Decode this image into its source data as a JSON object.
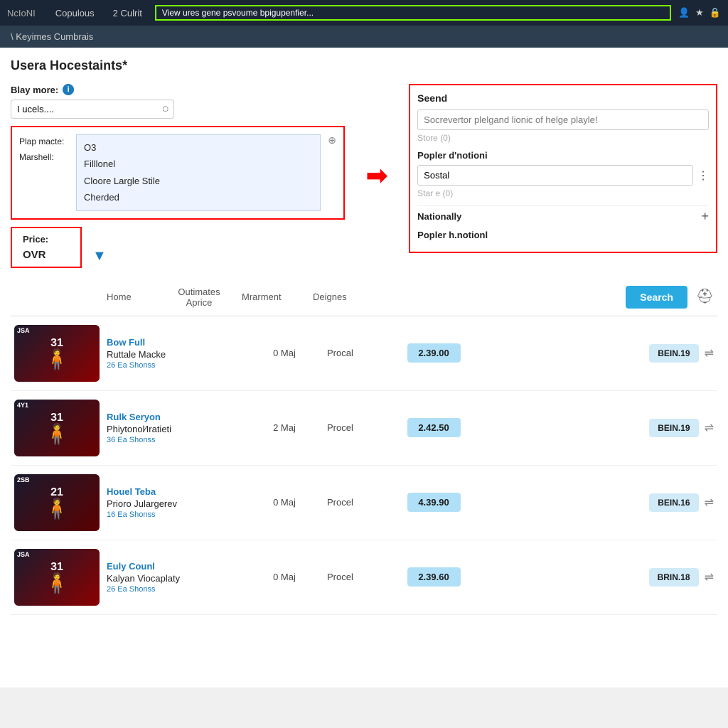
{
  "topnav": {
    "logo": "NcIoNI",
    "items": [
      "Copulous",
      "2 Culrit"
    ],
    "highlight": "View ures gene psvoume bpigupenfier...",
    "icons": [
      "👤",
      "★",
      "🔒"
    ]
  },
  "breadcrumb": {
    "text": "\\ Keyimes Cumbrais"
  },
  "page": {
    "title": "Usera Hocestaints*"
  },
  "filters": {
    "blay_more_label": "Blay more:",
    "blay_more_placeholder": "I ucels....",
    "info_icon": "i",
    "plap_macte_label": "Plap macte:",
    "marshell_label": "Marshell:",
    "plap_items": [
      "O3",
      "Filllonel",
      "Cloore Largle Stile",
      "Cherded"
    ],
    "seend_title": "Seend",
    "seend_placeholder": "Socrevertor plelgand lionic of helge playle!",
    "store_label": "Store (0)",
    "popler_label": "Popler d'notioni",
    "popler_value": "Sostal",
    "star_label": "Star e (0)",
    "nationally_label": "Nationally",
    "popler_h_label": "Popler h.notionl",
    "price_label": "Price:",
    "price_value": "OVR"
  },
  "table": {
    "headers": {
      "home": "Home",
      "outimates": "Outimates\nAprice",
      "mrarment": "Mrarment",
      "deignes": "Deignes",
      "search_btn": "Search"
    },
    "rows": [
      {
        "card_badge": "JSA",
        "card_num": "31",
        "name": "Bow Full",
        "subname": "Ruttale Macke",
        "meta": "26 Ea Shonss",
        "outimates": "0 Maj",
        "mrarment": "Procal",
        "price": "2.39.00",
        "action": "BEIN.19"
      },
      {
        "card_badge": "4Y1",
        "card_num": "31",
        "name": "Rulk Seryon",
        "subname": "Phiytonol∕Iratieti",
        "meta": "36 Ea Shonss",
        "outimates": "2 Maj",
        "mrarment": "Procel",
        "price": "2.42.50",
        "action": "BEIN.19"
      },
      {
        "card_badge": "2SB",
        "card_num": "21",
        "name": "Houel Teba",
        "subname": "Prioro Julargerev",
        "meta": "16 Ea Shonss",
        "outimates": "0 Maj",
        "mrarment": "Procel",
        "price": "4.39.90",
        "action": "BEIN.16"
      },
      {
        "card_badge": "JSA",
        "card_num": "31",
        "name": "Euly Counl",
        "subname": "Kalyan Viocaplaty",
        "meta": "26 Ea Shonss",
        "outimates": "0 Maj",
        "mrarment": "Procel",
        "price": "2.39.60",
        "action": "BRIN.18"
      }
    ]
  }
}
